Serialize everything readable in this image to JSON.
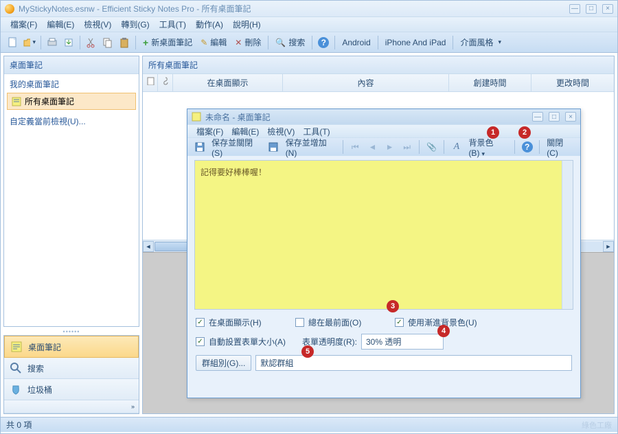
{
  "title": "MyStickyNotes.esnw - Efficient Sticky Notes Pro - 所有桌面筆記",
  "menu": {
    "file": "檔案(F)",
    "edit": "編輯(E)",
    "view": "檢視(V)",
    "goto": "轉到(G)",
    "tools": "工具(T)",
    "action": "動作(A)",
    "help": "說明(H)"
  },
  "toolbar": {
    "new": "新桌面筆記",
    "edit": "編輯",
    "delete": "刪除",
    "search": "搜索",
    "android": "Android",
    "iphone": "iPhone And iPad",
    "style": "介面風格"
  },
  "left": {
    "header": "桌面筆記",
    "tree_header": "我的桌面筆記",
    "tree_item": "所有桌面筆記",
    "custom_view": "自定義當前檢視(U)..."
  },
  "nav": {
    "notes": "桌面筆記",
    "search": "搜索",
    "trash": "垃圾桶"
  },
  "right_header": "所有桌面筆記",
  "cols": {
    "c1": "在桌面顯示",
    "c2": "內容",
    "c3": "創建時間",
    "c4": "更改時間"
  },
  "status": {
    "left": "共 0 項",
    "right": "綠色工廠"
  },
  "dialog": {
    "title": "未命名 - 桌面筆記",
    "menu": {
      "file": "檔案(F)",
      "edit": "編輯(E)",
      "view": "檢視(V)",
      "tools": "工具(T)"
    },
    "tb": {
      "saveclose": "保存並關閉(S)",
      "saveadd": "保存並增加(N)",
      "bgcolor": "背景色(B)",
      "close": "關閉(C)"
    },
    "note_text": "記得要好棒棒喔！",
    "chk_desktop": "在桌面顯示(H)",
    "chk_top": "總在最前面(O)",
    "chk_grad": "使用漸進背景色(U)",
    "chk_autosize": "自動設置表單大小(A)",
    "opacity_label": "表單透明度(R):",
    "opacity_value": "30% 透明",
    "group_btn": "群組別(G)...",
    "group_value": "默認群組"
  },
  "badges": {
    "b1": "1",
    "b2": "2",
    "b3": "3",
    "b4": "4",
    "b5": "5"
  }
}
